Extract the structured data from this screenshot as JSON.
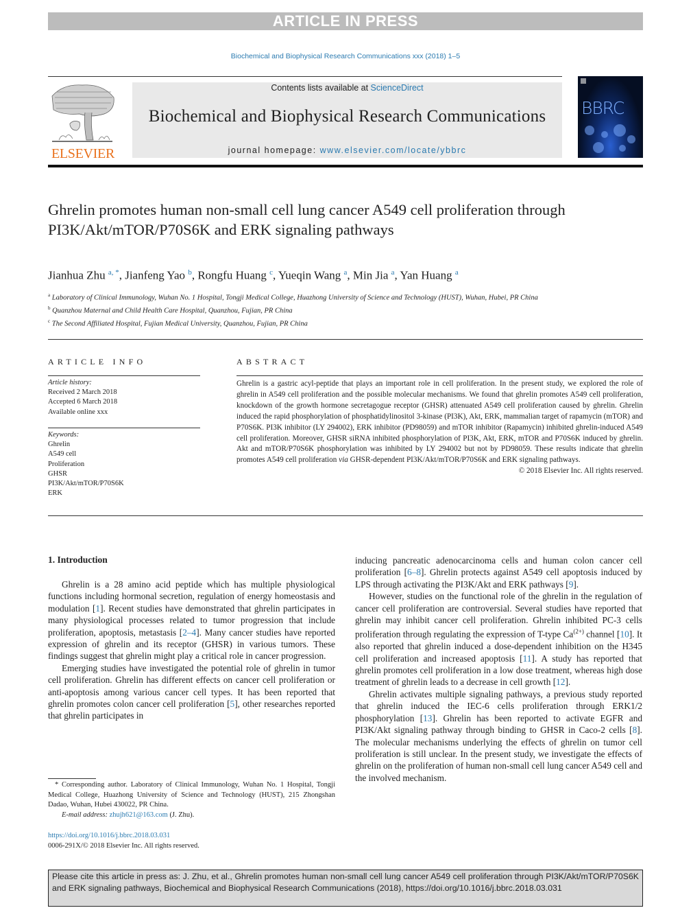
{
  "banner": "ARTICLE IN PRESS",
  "journal_ref": "Biochemical and Biophysical Research Communications xxx (2018) 1–5",
  "masthead": {
    "contents_prefix": "Contents lists available at ",
    "contents_link": "ScienceDirect",
    "journal_name": "Biochemical and Biophysical Research Communications",
    "homepage_prefix": "journal homepage: ",
    "homepage_link": "www.elsevier.com/locate/ybbrc",
    "publisher_logo_text": "ELSEVIER",
    "cover_text": "BBRC"
  },
  "article": {
    "title": "Ghrelin promotes human non-small cell lung cancer A549 cell proliferation through PI3K/Akt/mTOR/P70S6K and ERK signaling pathways",
    "authors": [
      {
        "name": "Jianhua Zhu",
        "sup": "a, *"
      },
      {
        "name": "Jianfeng Yao",
        "sup": "b"
      },
      {
        "name": "Rongfu Huang",
        "sup": "c"
      },
      {
        "name": "Yueqin Wang",
        "sup": "a"
      },
      {
        "name": "Min Jia",
        "sup": "a"
      },
      {
        "name": "Yan Huang",
        "sup": "a"
      }
    ],
    "affiliations": [
      {
        "key": "a",
        "text": "Laboratory of Clinical Immunology, Wuhan No. 1 Hospital, Tongji Medical College, Huazhong University of Science and Technology (HUST), Wuhan, Hubei, PR China"
      },
      {
        "key": "b",
        "text": "Quanzhou Maternal and Child Health Care Hospital, Quanzhou, Fujian, PR China"
      },
      {
        "key": "c",
        "text": "The Second Affiliated Hospital, Fujian Medical University, Quanzhou, Fujian, PR China"
      }
    ]
  },
  "article_info": {
    "header": "ARTICLE INFO",
    "history_label": "Article history:",
    "history": [
      "Received 2 March 2018",
      "Accepted 6 March 2018",
      "Available online xxx"
    ],
    "keywords_label": "Keywords:",
    "keywords": [
      "Ghrelin",
      "A549 cell",
      "Proliferation",
      "GHSR",
      "PI3K/Akt/mTOR/P70S6K",
      "ERK"
    ]
  },
  "abstract": {
    "header": "ABSTRACT",
    "text_1": "Ghrelin is a gastric acyl-peptide that plays an important role in cell proliferation. In the present study, we explored the role of ghrelin in A549 cell proliferation and the possible molecular mechanisms. We found that ghrelin promotes A549 cell proliferation, knockdown of the growth hormone secretagogue receptor (GHSR) attenuated A549 cell proliferation caused by ghrelin. Ghrelin induced the rapid phosphorylation of phosphatidylinositol 3-kinase (PI3K), Akt, ERK, mammalian target of rapamycin (mTOR) and P70S6K. PI3K inhibitor (LY 294002), ERK inhibitor (PD98059) and mTOR inhibitor (Rapamycin) inhibited ghrelin-induced A549 cell proliferation. Moreover, GHSR siRNA inhibited phosphorylation of PI3K, Akt, ERK, mTOR and P70S6K induced by ghrelin. Akt and mTOR/P70S6K phosphorylation was inhibited by LY 294002 but not by PD98059. These results indicate that ghrelin promotes A549 cell proliferation ",
    "text_italic": "via",
    "text_2": " GHSR-dependent PI3K/Akt/mTOR/P70S6K and ERK signaling pathways.",
    "copyright": "© 2018 Elsevier Inc. All rights reserved."
  },
  "introduction": {
    "heading": "1.  Introduction",
    "p1": {
      "a": "Ghrelin is a 28 amino acid peptide which has multiple physiological functions including hormonal secretion, regulation of energy homeostasis and modulation [",
      "r1": "1",
      "b": "]. Recent studies have demonstrated that ghrelin participates in many physiological processes related to tumor progression that include proliferation, apoptosis, metastasis [",
      "r2": "2–4",
      "c": "]. Many cancer studies have reported expression of ghrelin and its receptor (GHSR) in various tumors. These findings suggest that ghrelin might play a critical role in cancer progression."
    },
    "p2": {
      "a": "Emerging studies have investigated the potential role of ghrelin in tumor cell proliferation. Ghrelin has different effects on cancer cell proliferation or anti-apoptosis among various cancer cell types. It has been reported that ghrelin promotes colon cancer cell proliferation [",
      "r1": "5",
      "b": "], other researches reported that ghrelin participates in"
    },
    "p2_cont": {
      "a": "inducing pancreatic adenocarcinoma cells and human colon cancer cell proliferation [",
      "r1": "6–8",
      "b": "]. Ghrelin protects against A549 cell apoptosis induced by LPS through activating the PI3K/Akt and ERK pathways [",
      "r2": "9",
      "c": "]."
    },
    "p3": {
      "a": "However, studies on the functional role of the ghrelin in the regulation of cancer cell proliferation are controversial. Several studies have reported that ghrelin may inhibit cancer cell proliferation. Ghrelin inhibited PC-3 cells proliferation through regulating the expression of T-type Ca",
      "sup": "(2+)",
      "b": " channel [",
      "r1": "10",
      "c": "]. It also reported that ghrelin induced a dose-dependent inhibition on the H345 cell proliferation and increased apoptosis [",
      "r2": "11",
      "d": "]. A study has reported that ghrelin promotes cell proliferation in a low dose treatment, whereas high dose treatment of ghrelin leads to a decrease in cell growth [",
      "r3": "12",
      "e": "]."
    },
    "p4": {
      "a": "Ghrelin activates multiple signaling pathways, a previous study reported that ghrelin induced the IEC-6 cells proliferation through ERK1/2 phosphorylation [",
      "r1": "13",
      "b": "]. Ghrelin has been reported to activate EGFR and PI3K/Akt signaling pathway through binding to GHSR in Caco-2 cells [",
      "r2": "8",
      "c": "]. The molecular mechanisms underlying the effects of ghrelin on tumor cell proliferation is still unclear. In the present study, we investigate the effects of ghrelin on the proliferation of human non-small cell lung cancer A549 cell and the involved mechanism."
    }
  },
  "footnote": {
    "corresponding": "* Corresponding author. Laboratory of Clinical Immunology, Wuhan No. 1 Hospital, Tongji Medical College, Huazhong University of Science and Technology (HUST), 215 Zhongshan Dadao, Wuhan, Hubei 430022, PR China.",
    "email_label": "E-mail address: ",
    "email": "zhujh621@163.com",
    "email_suffix": " (J. Zhu).",
    "doi": "https://doi.org/10.1016/j.bbrc.2018.03.031",
    "issn": "0006-291X/© 2018 Elsevier Inc. All rights reserved."
  },
  "citation_box": "Please cite this article in press as: J. Zhu, et al., Ghrelin promotes human non-small cell lung cancer A549 cell proliferation through PI3K/Akt/mTOR/P70S6K and ERK signaling pathways, Biochemical and Biophysical Research Communications (2018), https://doi.org/10.1016/j.bbrc.2018.03.031"
}
